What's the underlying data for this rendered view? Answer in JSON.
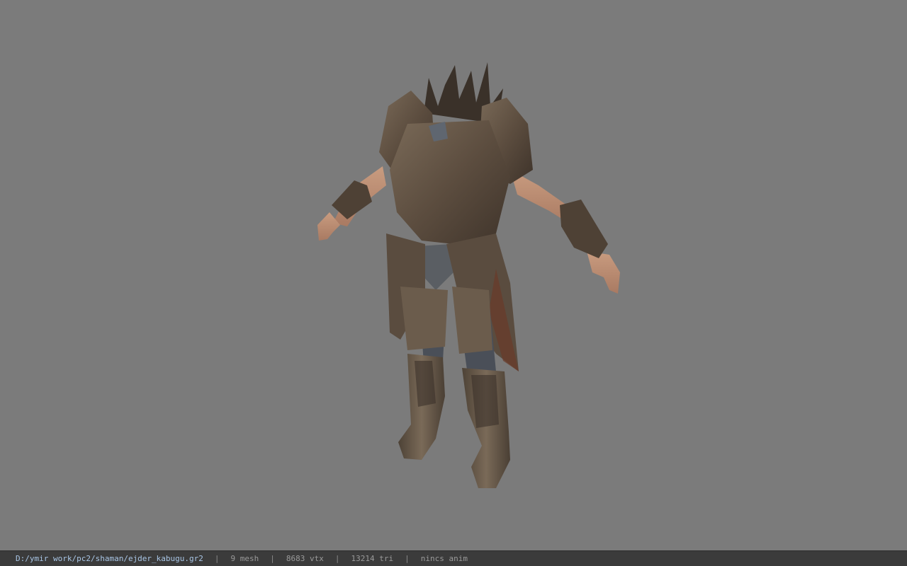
{
  "viewport": {
    "background_color": "#7b7b7b",
    "model_icon": "armor-model"
  },
  "status": {
    "file_path": "D:/ymir work/pc2/shaman/ejder_kabugu.gr2",
    "separator": "|",
    "mesh_count": "9 mesh",
    "vertex_count": "8683 vtx",
    "triangle_count": "13214 tri",
    "animation": "nincs anim"
  },
  "colors": {
    "statusbar_bg": "#3b3b3b",
    "path_text": "#a9c6e6",
    "info_text": "#9a9a9a"
  }
}
